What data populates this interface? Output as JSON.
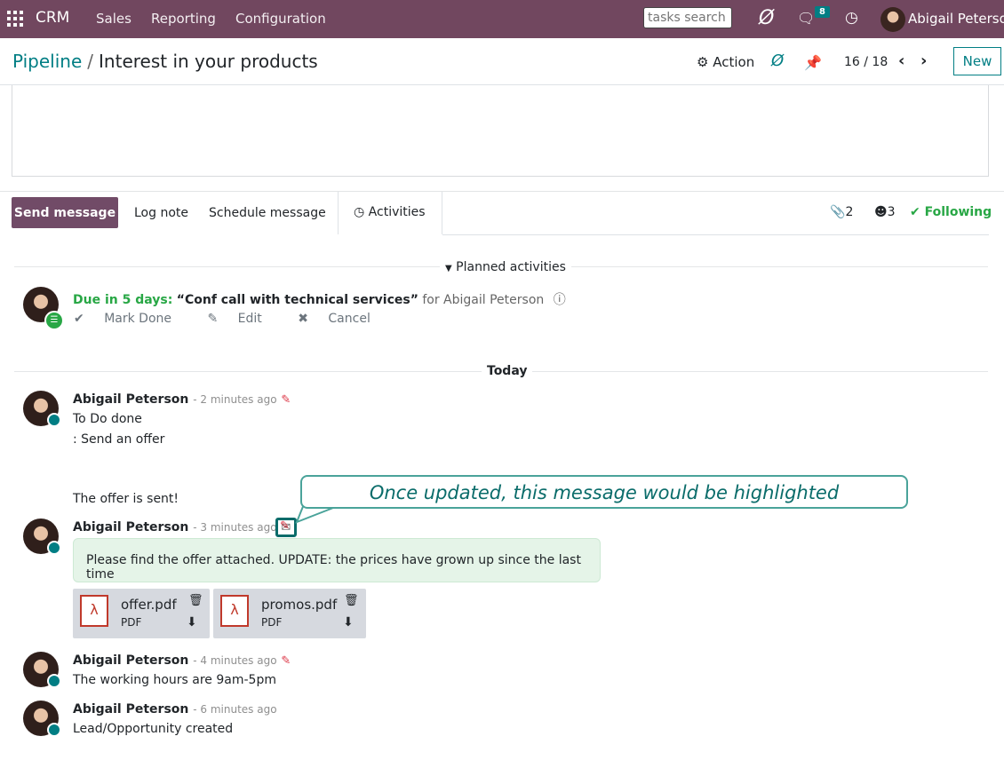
{
  "navbar": {
    "brand": "CRM",
    "menus": [
      "Sales",
      "Reporting",
      "Configuration"
    ],
    "search_placeholder": "tasks search",
    "messages_badge": "8",
    "user_name": "Abigail Peterson"
  },
  "control_panel": {
    "breadcrumb_parent": "Pipeline",
    "breadcrumb_separator": "/",
    "breadcrumb_current": "Interest in your products",
    "action_label": "Action",
    "pager": "16 / 18",
    "new_label": "New"
  },
  "chatter": {
    "send_message": "Send message",
    "log_note": "Log note",
    "schedule_message": "Schedule message",
    "activities": "Activities",
    "attachments_count": "2",
    "followers_count": "3",
    "following": "Following"
  },
  "planned": {
    "title": "Planned activities",
    "due_label": "Due in 5 days:",
    "summary": "“Conf call with technical services”",
    "for_text": "for Abigail Peterson",
    "mark_done": "Mark Done",
    "edit": "Edit",
    "cancel": "Cancel"
  },
  "today_label": "Today",
  "messages": [
    {
      "author": "Abigail Peterson",
      "date": "- 2 minutes ago",
      "lines": [
        "To Do done",
        ": Send an offer",
        "The offer is sent!"
      ]
    },
    {
      "author": "Abigail Peterson",
      "date": "- 3 minutes ago",
      "body": "Please find the offer attached. UPDATE: the prices have grown up since the last time"
    },
    {
      "author": "Abigail Peterson",
      "date": "- 4 minutes ago",
      "body": "The working hours are 9am-5pm"
    },
    {
      "author": "Abigail Peterson",
      "date": "- 6 minutes ago",
      "body": "Lead/Opportunity created"
    }
  ],
  "attachments": [
    {
      "name": "offer.pdf",
      "type": "PDF"
    },
    {
      "name": "promos.pdf",
      "type": "PDF"
    }
  ],
  "annotation": {
    "text": "Once updated, this message would be highlighted",
    "color": "#0a6c6a"
  },
  "colors": {
    "navbar": "#71475f",
    "primary": "#714b67",
    "link": "#017e84",
    "success": "#28a745",
    "danger": "#dc3545"
  }
}
